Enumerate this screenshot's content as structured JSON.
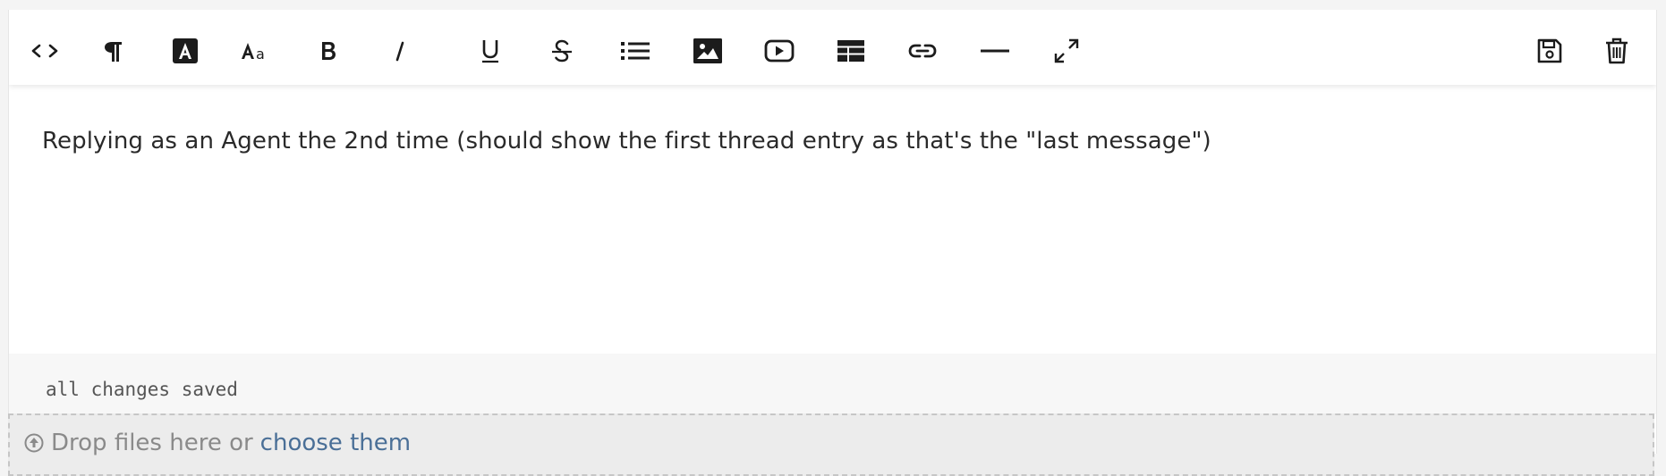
{
  "toolbar": {
    "buttons": [
      {
        "name": "code-view",
        "icon": "code-icon"
      },
      {
        "name": "paragraph-format",
        "icon": "paragraph-icon"
      },
      {
        "name": "text-color",
        "icon": "text-color-icon"
      },
      {
        "name": "font-size",
        "icon": "font-size-icon",
        "label": "Aa"
      },
      {
        "name": "bold",
        "icon": "bold-icon",
        "label": "B"
      },
      {
        "name": "italic",
        "icon": "italic-icon",
        "label": "I"
      },
      {
        "name": "underline",
        "icon": "underline-icon",
        "label": "U"
      },
      {
        "name": "strikethrough",
        "icon": "strikethrough-icon",
        "label": "S"
      },
      {
        "name": "list",
        "icon": "list-icon"
      },
      {
        "name": "image",
        "icon": "image-icon"
      },
      {
        "name": "video",
        "icon": "video-icon"
      },
      {
        "name": "table",
        "icon": "table-icon"
      },
      {
        "name": "link",
        "icon": "link-icon"
      },
      {
        "name": "horizontal-rule",
        "icon": "horizontal-rule-icon"
      },
      {
        "name": "fullscreen",
        "icon": "expand-icon"
      }
    ],
    "right_buttons": [
      {
        "name": "save-draft",
        "icon": "floppy-disk-icon"
      },
      {
        "name": "delete-draft",
        "icon": "trash-icon"
      }
    ]
  },
  "editor": {
    "content": "Replying as an Agent the 2nd time (should show the first thread entry as that's the \"last message\")"
  },
  "status": {
    "text": "all changes saved"
  },
  "dropzone": {
    "text": "Drop files here or",
    "link": "choose them"
  },
  "colors": {
    "icon": "#1c1c1c",
    "link": "#4a6f97",
    "status_text": "#555555",
    "dropzone_bg": "#ececec"
  }
}
